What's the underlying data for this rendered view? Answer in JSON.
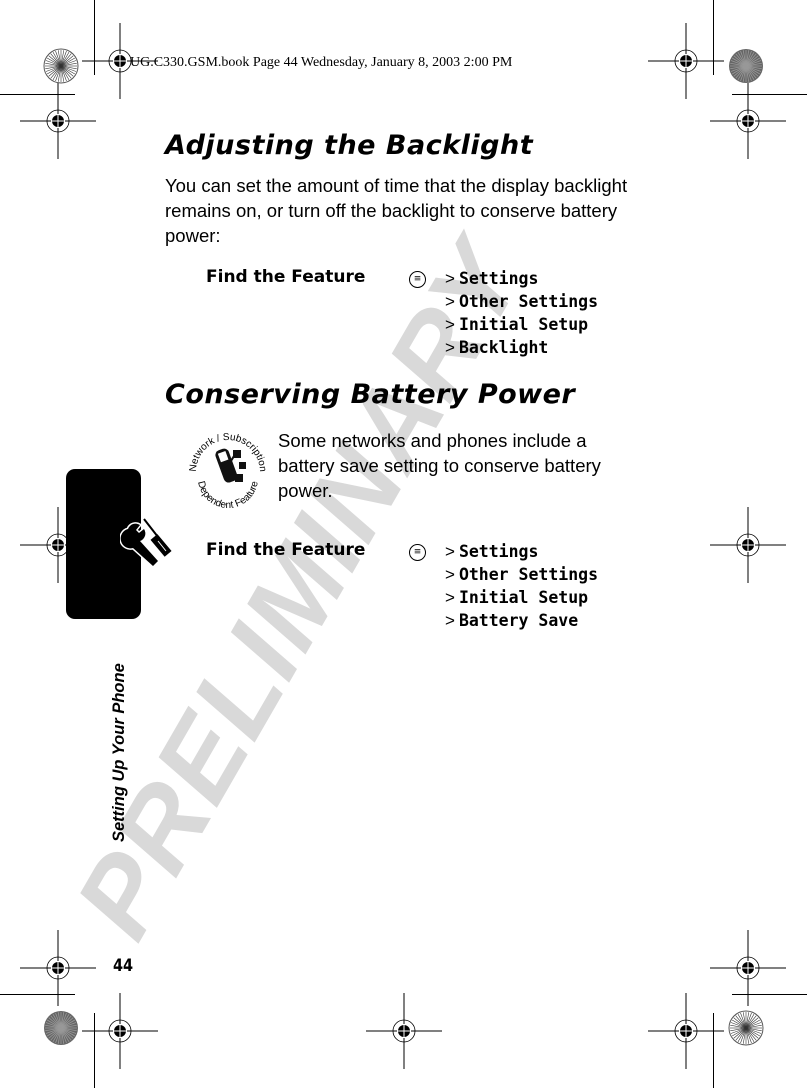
{
  "print_slug": "UG.C330.GSM.book  Page 44  Wednesday, January 8, 2003  2:00 PM",
  "watermark": "PRELIMINARY",
  "side_title": "Setting Up Your Phone",
  "page_number": "44",
  "sections": [
    {
      "heading": "Adjusting the Backlight",
      "body": "You can set the amount of time that the display backlight remains on, or turn off the backlight to conserve battery power:",
      "find_feature": {
        "label": "Find the Feature",
        "menu_key_icon": "menu-key-icon",
        "path": [
          "Settings",
          "Other Settings",
          "Initial Setup",
          "Backlight"
        ]
      }
    },
    {
      "heading": "Conserving Battery Power",
      "badge_icon": "network-subscription-dependent-feature-icon",
      "badge_text_top": "Network / Subscription",
      "badge_text_bottom": "Dependent Feature",
      "body": "Some networks and phones include a battery save setting to conserve battery power.",
      "find_feature": {
        "label": "Find the Feature",
        "menu_key_icon": "menu-key-icon",
        "path": [
          "Settings",
          "Other Settings",
          "Initial Setup",
          "Battery Save"
        ]
      }
    }
  ],
  "separator": ">",
  "chapter_tab_icon": "wrench-screwdriver-icon"
}
